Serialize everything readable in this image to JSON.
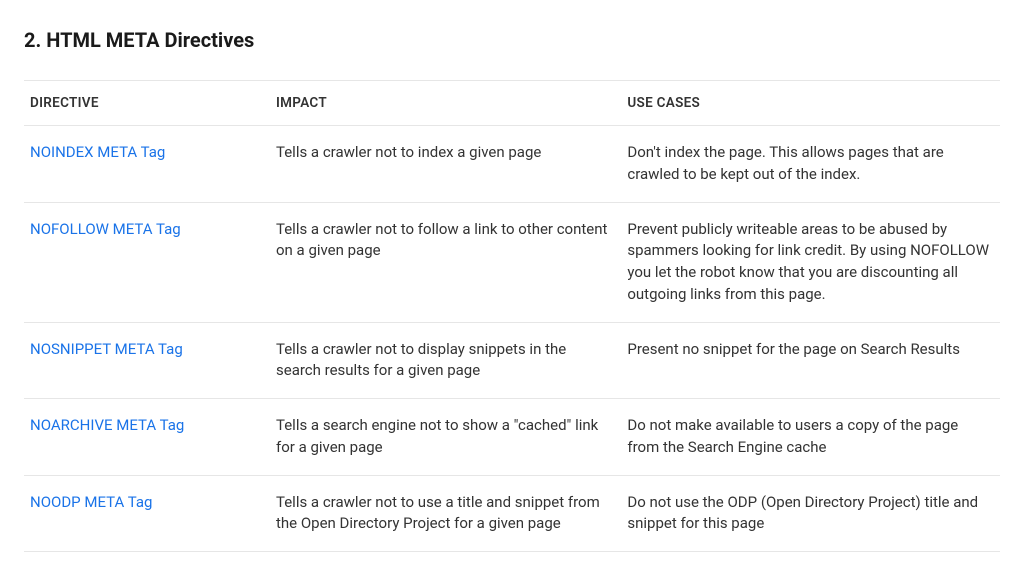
{
  "heading": "2. HTML META Directives",
  "table": {
    "headers": {
      "directive": "DIRECTIVE",
      "impact": "IMPACT",
      "usecases": "USE CASES"
    },
    "rows": [
      {
        "directive": "NOINDEX META Tag",
        "impact": "Tells a crawler not to index a given page",
        "usecases": "Don't index the page. This allows pages that are crawled to be kept out of the index."
      },
      {
        "directive": "NOFOLLOW META Tag",
        "impact": "Tells a crawler not to follow a link to other content on a given page",
        "usecases": "Prevent publicly writeable areas to be abused by spammers looking for link credit. By using NOFOLLOW you let the robot know that you are discounting all outgoing links from this page."
      },
      {
        "directive": "NOSNIPPET META Tag",
        "impact": "Tells a crawler not to display snippets in the search results for a given page",
        "usecases": "Present no snippet for the page on Search Results"
      },
      {
        "directive": "NOARCHIVE META Tag",
        "impact": "Tells a search engine not to show a \"cached\" link for a given page",
        "usecases": "Do not make available to users a copy of the page from the Search Engine cache"
      },
      {
        "directive": "NOODP META Tag",
        "impact": "Tells a crawler not to use a title and snippet from the Open Directory Project for a given page",
        "usecases": "Do not use the ODP (Open Directory Project) title and snippet for this page"
      }
    ]
  }
}
